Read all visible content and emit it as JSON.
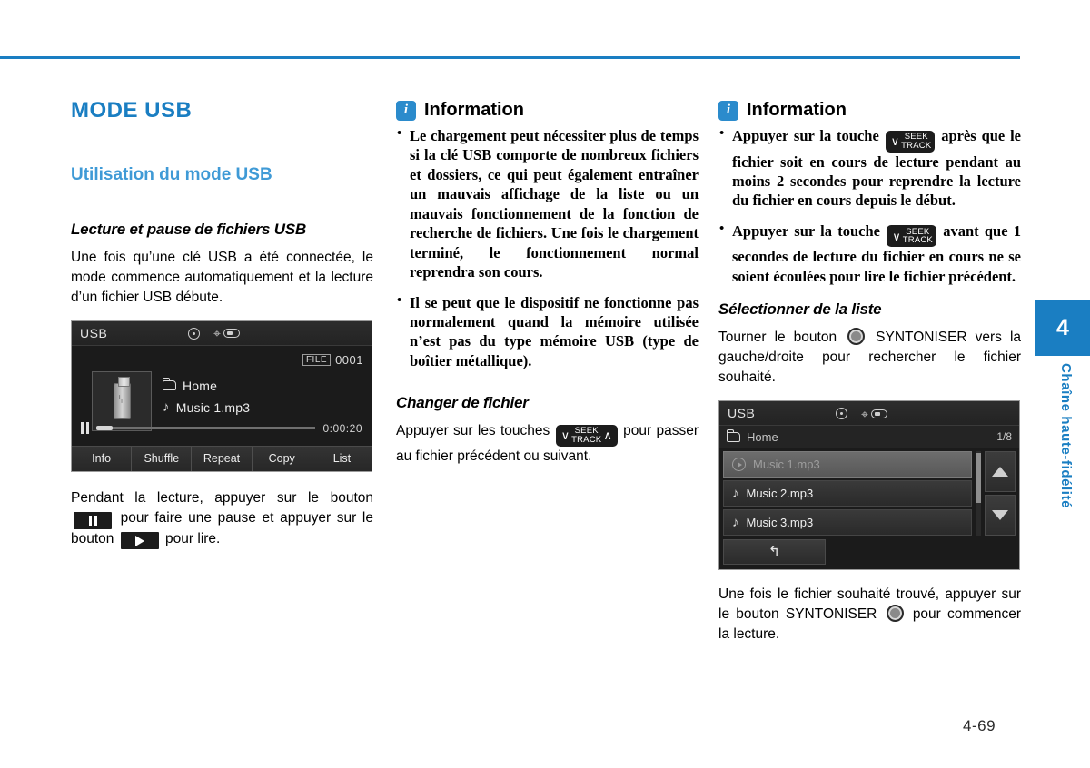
{
  "page": {
    "number": "4-69",
    "chapter_number": "4",
    "chapter_label": "Chaîne haute-fidélité",
    "accent_color": "#1a7ec2",
    "subheading_color": "#3f9ad6"
  },
  "col1": {
    "title": "MODE USB",
    "subtitle": "Utilisation du mode USB",
    "section_heading": "Lecture et pause de fichiers USB",
    "paragraph": "Une fois qu’une clé USB a été connectée, le mode commence automatiquement et la lecture d’un fichier USB débute.",
    "caption_part1": "Pendant la lecture, appuyer sur le bouton",
    "caption_part2": "pour faire une pause et appuyer sur le bouton",
    "caption_part3": "pour lire.",
    "pause_key_icon": "pause-icon",
    "play_key_icon": "play-icon"
  },
  "now_playing_screen": {
    "source": "USB",
    "icons": [
      "disc-icon",
      "usb-icon"
    ],
    "file_label": "FILE",
    "file_number": "0001",
    "album_art_icon": "usb-stick-icon",
    "folder_icon": "folder-icon",
    "folder_name": "Home",
    "note_icon": "music-note-icon",
    "track_name": "Music 1.mp3",
    "transport_state_icon": "pause-icon",
    "elapsed_time": "0:00:20",
    "tabs": [
      "Info",
      "Shuffle",
      "Repeat",
      "Copy",
      "List"
    ]
  },
  "col2": {
    "info_title": "Information",
    "info_icon": "info-icon",
    "bullets": [
      "Le chargement peut nécessiter plus de temps si la clé USB comporte de nombreux fichiers et dossiers, ce qui peut également entraîner un mauvais affichage de la liste ou un mauvais fonctionnement de la fonction de recherche de fichiers. Une fois le chargement terminé, le fonctionnement normal reprendra son cours.",
      "Il se peut que le dispositif ne fonctionne pas normalement quand la mémoire utilisée n’est pas du type mémoire USB (type de boîtier métallique)."
    ],
    "section_heading": "Changer de fichier",
    "paragraph_part1": "Appuyer sur les touches",
    "paragraph_part2": "pour passer au fichier précédent ou suivant.",
    "seek_key": {
      "icon": "seek-track-key-icon",
      "line1": "SEEK",
      "line2": "TRACK",
      "left_chevron": "∨",
      "right_chevron": "∧"
    }
  },
  "col3": {
    "info_title": "Information",
    "info_icon": "info-icon",
    "bullets": [
      {
        "part1": "Appuyer sur la touche",
        "part2": "après que le fichier soit en cours de lecture pendant au moins 2 secondes pour reprendre la lecture du fichier en cours depuis le début."
      },
      {
        "part1": "Appuyer sur la touche",
        "part2": "avant que 1 secondes de lecture du fichier en cours ne se soient écoulées pour lire le fichier précédent."
      }
    ],
    "seek_key": {
      "icon": "seek-track-key-icon",
      "line1": "SEEK",
      "line2": "TRACK",
      "left_chevron": "∨"
    },
    "section_heading": "Sélectionner de la liste",
    "paragraph_part1": "Tourner le bouton",
    "paragraph_part2": "SYNTONISER vers la gauche/droite pour rechercher le fichier souhaité.",
    "tune_knob_icon": "tune-knob-icon",
    "closing_part1": "Une fois le fichier souhaité trouvé, appuyer sur le bouton SYNTONISER",
    "closing_part2": "pour commencer la lecture."
  },
  "list_screen": {
    "source": "USB",
    "icons": [
      "disc-icon",
      "usb-icon"
    ],
    "folder_icon": "folder-icon",
    "folder_name": "Home",
    "page_counter": "1/8",
    "rows": [
      {
        "label": "Music 1.mp3",
        "icon": "play-circle-icon",
        "selected": true
      },
      {
        "label": "Music 2.mp3",
        "icon": "music-note-icon",
        "selected": false
      },
      {
        "label": "Music 3.mp3",
        "icon": "music-note-icon",
        "selected": false
      }
    ],
    "scroll_up_icon": "triangle-up-icon",
    "scroll_down_icon": "triangle-down-icon",
    "back_button_icon": "back-arrow-icon",
    "back_button_glyph": "↰"
  }
}
